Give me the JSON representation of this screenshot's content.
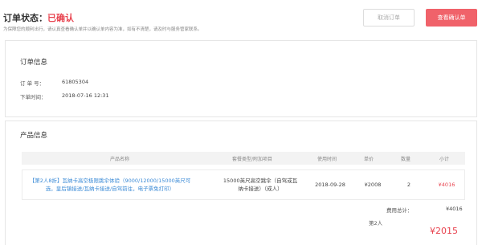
{
  "status": {
    "label": "订单状态：",
    "value": "已确认",
    "note": "为保障您的顺利出行，请认真查看确认单并以确认单内容为准，如有不清楚，请及时与服务管家联系。",
    "cancel_button": "取消订单",
    "view_button": "查看确认单"
  },
  "order_info": {
    "title": "订单信息",
    "order_no_label": "订 单 号：",
    "order_no": "61805304",
    "order_time_label": "下单时间：",
    "order_time": "2018-07-16 12:31"
  },
  "product_info": {
    "title": "产品信息",
    "columns": [
      "产品名称",
      "套餐类型/附加项目",
      "使用时间",
      "单价",
      "数量",
      "小计"
    ],
    "row": {
      "name": "【第2人8折】瓦纳卡高空极限跳伞体验（9000/12000/15000英尺可选，皇后镇接送/瓦纳卡接送/自驾前往，电子票免打印）",
      "package": "15000英尺高空跳伞（自驾或瓦纳卡接送）（成人）",
      "date": "2018-09-28",
      "price": "¥2008",
      "qty": "2",
      "subtotal": "¥4016"
    },
    "total_label": "费用总计：",
    "total_value": "¥4016",
    "discount_label": "第2人",
    "big_total": "¥2015"
  }
}
